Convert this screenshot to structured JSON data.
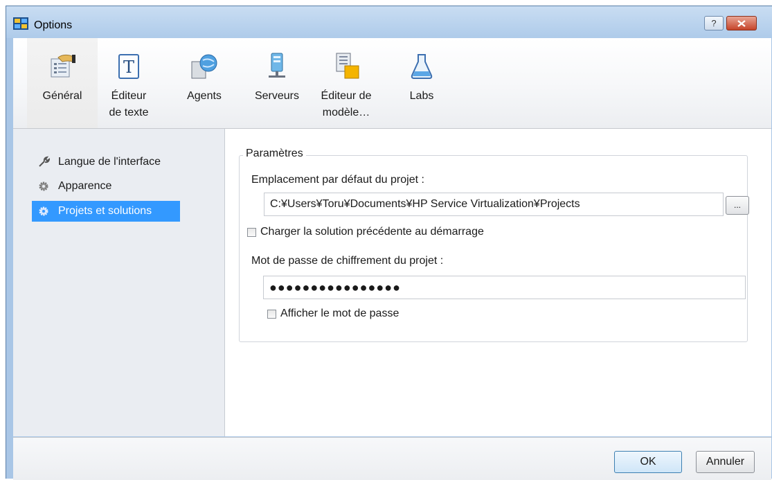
{
  "window": {
    "title": "Options",
    "help_label": "?",
    "close_label": "✕"
  },
  "toolbar": {
    "items": [
      {
        "label": "Général",
        "selected": true
      },
      {
        "label": "Éditeur de texte"
      },
      {
        "label": "Agents"
      },
      {
        "label": "Serveurs"
      },
      {
        "label": "Éditeur de modèle…"
      },
      {
        "label": "Labs"
      }
    ]
  },
  "sidebar": {
    "items": [
      {
        "label": "Langue de l'interface",
        "icon": "wrench-icon"
      },
      {
        "label": "Apparence",
        "icon": "gear-icon"
      },
      {
        "label": "Projets et solutions",
        "icon": "gear-icon",
        "selected": true
      }
    ]
  },
  "settings": {
    "group_title": "Paramètres",
    "default_location_label": "Emplacement par défaut du projet :",
    "default_location_value": "C:¥Users¥Toru¥Documents¥HP Service Virtualization¥Projects",
    "browse_label": "...",
    "load_previous_label": "Charger la solution précédente au démarrage",
    "load_previous_checked": false,
    "password_label": "Mot de passe de chiffrement du projet :",
    "password_value": "●●●●●●●●●●●●●●●●",
    "show_password_label": "Afficher le mot de passe",
    "show_password_checked": false
  },
  "footer": {
    "ok_label": "OK",
    "cancel_label": "Annuler"
  },
  "colors": {
    "selection": "#3399ff",
    "frame": "#a9c6e6"
  }
}
